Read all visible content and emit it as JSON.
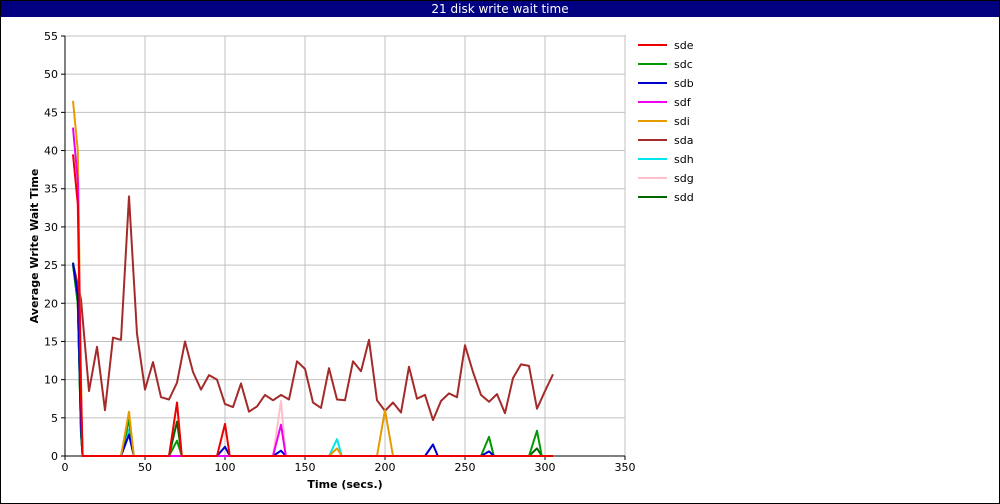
{
  "chart_data": {
    "type": "line",
    "title": "21 disk write wait time",
    "xlabel": "Time (secs.)",
    "ylabel": "Average Write Wait Time",
    "xlim": [
      0,
      350
    ],
    "ylim": [
      0,
      55
    ],
    "xticks": [
      0,
      50,
      100,
      150,
      200,
      250,
      300,
      350
    ],
    "yticks": [
      0,
      5,
      10,
      15,
      20,
      25,
      30,
      35,
      40,
      45,
      50,
      55
    ],
    "grid": true,
    "legend_position": "right",
    "series": [
      {
        "name": "sde",
        "color": "#ee0000",
        "points": [
          [
            5,
            39.5
          ],
          [
            8,
            33
          ],
          [
            10,
            8
          ],
          [
            11,
            0
          ],
          [
            65,
            0
          ],
          [
            70,
            7
          ],
          [
            73,
            0
          ],
          [
            95,
            0
          ],
          [
            100,
            4.2
          ],
          [
            103,
            0
          ],
          [
            305,
            0
          ]
        ]
      },
      {
        "name": "sdc",
        "color": "#009900",
        "points": [
          [
            5,
            25
          ],
          [
            8,
            20
          ],
          [
            10,
            3
          ],
          [
            11,
            0
          ],
          [
            35,
            0
          ],
          [
            40,
            4.8
          ],
          [
            43,
            0
          ],
          [
            65,
            0
          ],
          [
            70,
            2
          ],
          [
            73,
            0
          ],
          [
            260,
            0
          ],
          [
            265,
            2.5
          ],
          [
            268,
            0
          ],
          [
            290,
            0
          ],
          [
            295,
            3.3
          ],
          [
            298,
            0
          ],
          [
            305,
            0
          ]
        ]
      },
      {
        "name": "sdb",
        "color": "#0000cc",
        "points": [
          [
            5,
            25.3
          ],
          [
            8,
            21
          ],
          [
            10,
            4
          ],
          [
            11,
            0
          ],
          [
            35,
            0
          ],
          [
            40,
            2.8
          ],
          [
            43,
            0
          ],
          [
            95,
            0
          ],
          [
            100,
            1.2
          ],
          [
            103,
            0
          ],
          [
            130,
            0
          ],
          [
            135,
            0.7
          ],
          [
            138,
            0
          ],
          [
            225,
            0
          ],
          [
            230,
            1.5
          ],
          [
            233,
            0
          ],
          [
            260,
            0
          ],
          [
            265,
            0.6
          ],
          [
            268,
            0
          ],
          [
            305,
            0
          ]
        ]
      },
      {
        "name": "sdf",
        "color": "#ee00ee",
        "points": [
          [
            5,
            43
          ],
          [
            8,
            36
          ],
          [
            10,
            8
          ],
          [
            11,
            0
          ],
          [
            130,
            0
          ],
          [
            135,
            4.1
          ],
          [
            138,
            0
          ],
          [
            305,
            0
          ]
        ]
      },
      {
        "name": "sdi",
        "color": "#e69a00",
        "points": [
          [
            5,
            46.5
          ],
          [
            8,
            40
          ],
          [
            10,
            10
          ],
          [
            11,
            0
          ],
          [
            35,
            0
          ],
          [
            40,
            5.8
          ],
          [
            43,
            0
          ],
          [
            165,
            0
          ],
          [
            170,
            1
          ],
          [
            173,
            0
          ],
          [
            195,
            0
          ],
          [
            200,
            6
          ],
          [
            205,
            0
          ],
          [
            305,
            0
          ]
        ]
      },
      {
        "name": "sda",
        "color": "#a52a2a",
        "points": [
          [
            5,
            25.3
          ],
          [
            10,
            20.5
          ],
          [
            15,
            8.5
          ],
          [
            20,
            14.3
          ],
          [
            25,
            6
          ],
          [
            30,
            15.5
          ],
          [
            35,
            15.2
          ],
          [
            40,
            34
          ],
          [
            45,
            16
          ],
          [
            50,
            8.7
          ],
          [
            55,
            12.3
          ],
          [
            60,
            7.7
          ],
          [
            65,
            7.4
          ],
          [
            70,
            9.6
          ],
          [
            75,
            15
          ],
          [
            80,
            11
          ],
          [
            85,
            8.7
          ],
          [
            90,
            10.6
          ],
          [
            95,
            10
          ],
          [
            100,
            6.8
          ],
          [
            105,
            6.4
          ],
          [
            110,
            9.5
          ],
          [
            115,
            5.8
          ],
          [
            120,
            6.5
          ],
          [
            125,
            8
          ],
          [
            130,
            7.3
          ],
          [
            135,
            8
          ],
          [
            140,
            7.4
          ],
          [
            145,
            12.4
          ],
          [
            150,
            11.4
          ],
          [
            155,
            7
          ],
          [
            160,
            6.3
          ],
          [
            165,
            11.5
          ],
          [
            170,
            7.4
          ],
          [
            175,
            7.3
          ],
          [
            180,
            12.4
          ],
          [
            185,
            11.1
          ],
          [
            190,
            15.2
          ],
          [
            195,
            7.3
          ],
          [
            200,
            5.9
          ],
          [
            205,
            7
          ],
          [
            210,
            5.7
          ],
          [
            215,
            11.7
          ],
          [
            220,
            7.5
          ],
          [
            225,
            8
          ],
          [
            230,
            4.7
          ],
          [
            235,
            7.2
          ],
          [
            240,
            8.2
          ],
          [
            245,
            7.7
          ],
          [
            250,
            14.5
          ],
          [
            255,
            11
          ],
          [
            260,
            8
          ],
          [
            265,
            7.1
          ],
          [
            270,
            8.1
          ],
          [
            275,
            5.6
          ],
          [
            280,
            10.2
          ],
          [
            285,
            12
          ],
          [
            290,
            11.8
          ],
          [
            295,
            6.2
          ],
          [
            300,
            8.5
          ],
          [
            305,
            10.7
          ]
        ]
      },
      {
        "name": "sdh",
        "color": "#00e5ee",
        "points": [
          [
            5,
            25.3
          ],
          [
            8,
            20
          ],
          [
            10,
            3
          ],
          [
            11,
            0
          ],
          [
            35,
            0
          ],
          [
            40,
            3.5
          ],
          [
            43,
            0
          ],
          [
            165,
            0
          ],
          [
            170,
            2.2
          ],
          [
            173,
            0
          ],
          [
            305,
            0
          ]
        ]
      },
      {
        "name": "sdg",
        "color": "#ffc0cb",
        "points": [
          [
            5,
            25.3
          ],
          [
            8,
            20
          ],
          [
            10,
            3
          ],
          [
            11,
            0
          ],
          [
            130,
            0
          ],
          [
            135,
            7.2
          ],
          [
            138,
            0
          ],
          [
            305,
            0
          ]
        ]
      },
      {
        "name": "sdd",
        "color": "#006600",
        "points": [
          [
            5,
            25.3
          ],
          [
            8,
            20
          ],
          [
            10,
            3
          ],
          [
            11,
            0
          ],
          [
            35,
            0
          ],
          [
            40,
            4.8
          ],
          [
            43,
            0
          ],
          [
            65,
            0
          ],
          [
            70,
            4.5
          ],
          [
            73,
            0
          ],
          [
            290,
            0
          ],
          [
            295,
            1
          ],
          [
            298,
            0
          ],
          [
            305,
            0
          ]
        ]
      }
    ]
  }
}
